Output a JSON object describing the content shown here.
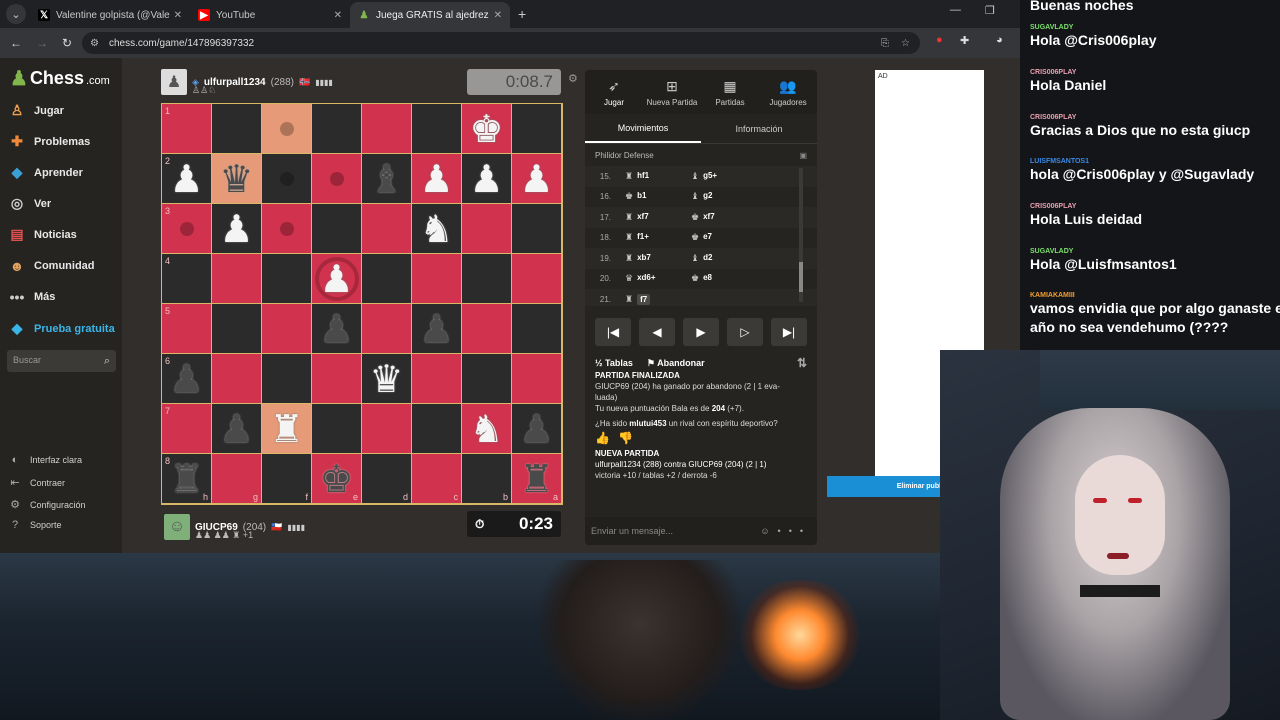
{
  "browser": {
    "tabs": [
      {
        "title": "Valentine golpista (@Valencuen",
        "icon": "x-logo-icon",
        "fav": "𝕏",
        "favbg": "#000000",
        "favcolor": "#ffffff"
      },
      {
        "title": "YouTube",
        "icon": "youtube-icon",
        "fav": "▶",
        "favbg": "#ff0000",
        "favcolor": "#ffffff"
      },
      {
        "title": "Juega GRATIS al ajedrez onl",
        "icon": "chess-pawn-icon",
        "fav": "♟",
        "favbg": "#35363a",
        "favcolor": "#81b64c"
      }
    ],
    "url": "chess.com/game/147896397332"
  },
  "sidebar": {
    "logo_text": "Chess",
    "logo_suffix": ".com",
    "items": [
      {
        "label": "Jugar",
        "icon": "play-icon",
        "glyph": "♙",
        "color": "#f0a050"
      },
      {
        "label": "Problemas",
        "icon": "puzzle-icon",
        "glyph": "✚",
        "color": "#f08a3a"
      },
      {
        "label": "Aprender",
        "icon": "learn-icon",
        "glyph": "◆",
        "color": "#3aa0d8"
      },
      {
        "label": "Ver",
        "icon": "binoculars-icon",
        "glyph": "◎",
        "color": "#cccccc"
      },
      {
        "label": "Noticias",
        "icon": "news-icon",
        "glyph": "▤",
        "color": "#e05050"
      },
      {
        "label": "Comunidad",
        "icon": "community-icon",
        "glyph": "☻",
        "color": "#e0a060"
      },
      {
        "label": "Más",
        "icon": "more-icon",
        "glyph": "•••",
        "color": "#cccccc"
      },
      {
        "label": "Prueba gratuita",
        "icon": "diamond-icon",
        "glyph": "◆",
        "color": "#3ab5e8"
      }
    ],
    "search_placeholder": "Buscar",
    "bottom": [
      {
        "label": "Interfaz clara",
        "icon": "theme-icon",
        "glyph": "◐"
      },
      {
        "label": "Contraer",
        "icon": "collapse-icon",
        "glyph": "⇤"
      },
      {
        "label": "Configuración",
        "icon": "settings-icon",
        "glyph": "⚙"
      },
      {
        "label": "Soporte",
        "icon": "support-icon",
        "glyph": "?"
      }
    ]
  },
  "game": {
    "top_player": {
      "name": "ulfurpall1234",
      "rating": "(288)",
      "flag": "🇳🇴",
      "clock": "0:08.7"
    },
    "bottom_player": {
      "name": "GIUCP69",
      "rating": "(204)",
      "flag": "🇨🇱",
      "clock": "0:23"
    },
    "ranks": [
      "1",
      "2",
      "3",
      "4",
      "5",
      "6",
      "7",
      "8"
    ],
    "files": [
      "h",
      "g",
      "f",
      "e",
      "d",
      "c",
      "b",
      "a"
    ]
  },
  "panel": {
    "tabs": [
      {
        "label": "Jugar",
        "icon": "play-tab-icon",
        "glyph": "➶"
      },
      {
        "label": "Nueva Partida",
        "icon": "new-game-icon",
        "glyph": "⊞"
      },
      {
        "label": "Partidas",
        "icon": "games-icon",
        "glyph": "▦"
      },
      {
        "label": "Jugadores",
        "icon": "players-icon",
        "glyph": "👥"
      }
    ],
    "subtabs": [
      "Movimientos",
      "Información"
    ],
    "opening": "Philidor Defense",
    "moves": [
      {
        "n": "15.",
        "w_piece": "♜",
        "w": "hf1",
        "b_piece": "♝",
        "b": "g5+"
      },
      {
        "n": "16.",
        "w_piece": "♚",
        "w": "b1",
        "b_piece": "♝",
        "b": "g2"
      },
      {
        "n": "17.",
        "w_piece": "♜",
        "w": "xf7",
        "b_piece": "♚",
        "b": "xf7"
      },
      {
        "n": "18.",
        "w_piece": "♜",
        "w": "f1+",
        "b_piece": "♚",
        "b": "e7"
      },
      {
        "n": "19.",
        "w_piece": "♜",
        "w": "xb7",
        "b_piece": "♝",
        "b": "d2"
      },
      {
        "n": "20.",
        "w_piece": "♛",
        "w": "xd6+",
        "b_piece": "♚",
        "b": "e8"
      },
      {
        "n": "21.",
        "w_piece": "♜",
        "w": "f7",
        "b_piece": "",
        "b": ""
      }
    ],
    "draw_label": "Tablas",
    "resign_label": "Abandonar",
    "log": {
      "header_cut": "PARTIDA FINALIZADA",
      "line1a": "GIUCP69 (204) ha ganado por abandono (2 | 1 eva-",
      "line1b": "luada)",
      "line2a": "Tu nueva puntuación Bala es de ",
      "line2b": "204",
      "line2c": " (+7).",
      "line3a": "¿Ha sido ",
      "line3b": "mlutui453",
      "line3c": " un rival con espíritu deportivo?",
      "new_game": "NUEVA PARTIDA",
      "line4": "ulfurpall1234 (288) contra GIUCP69 (204) (2 | 1)",
      "line5": "victoria +10 / tablas +2 / derrota -6"
    },
    "message_placeholder": "Enviar un mensaje..."
  },
  "ad": {
    "label": "AD",
    "remove_label": "Eliminar publicidad"
  },
  "chat": {
    "messages": [
      {
        "user": "",
        "text": "Buenas noches",
        "color": "#ffffff"
      },
      {
        "user": "SUGAVLADY",
        "text": "Hola @Cris006play",
        "color": "#7be06b"
      },
      {
        "user": "CRIS006PLAY",
        "text": "Hola Daniel",
        "color": "#e8a0b0"
      },
      {
        "user": "CRIS006PLAY",
        "text": "Gracias a Dios que no esta giucp",
        "color": "#e8a0b0"
      },
      {
        "user": "LUISFMSANTOS1",
        "text": "hola @Cris006play y @Sugavlady",
        "color": "#3a8ae8"
      },
      {
        "user": "CRIS006PLAY",
        "text": "Hola Luis deidad",
        "color": "#e8a0b0"
      },
      {
        "user": "SUGAVLADY",
        "text": "Hola @Luisfmsantos1",
        "color": "#7be06b"
      },
      {
        "user": "KAMIAKAMIII",
        "text": "vamos envidia que por algo ganaste el c",
        "text2": "año no sea vendehumo (????",
        "color": "#f0a030"
      }
    ]
  }
}
